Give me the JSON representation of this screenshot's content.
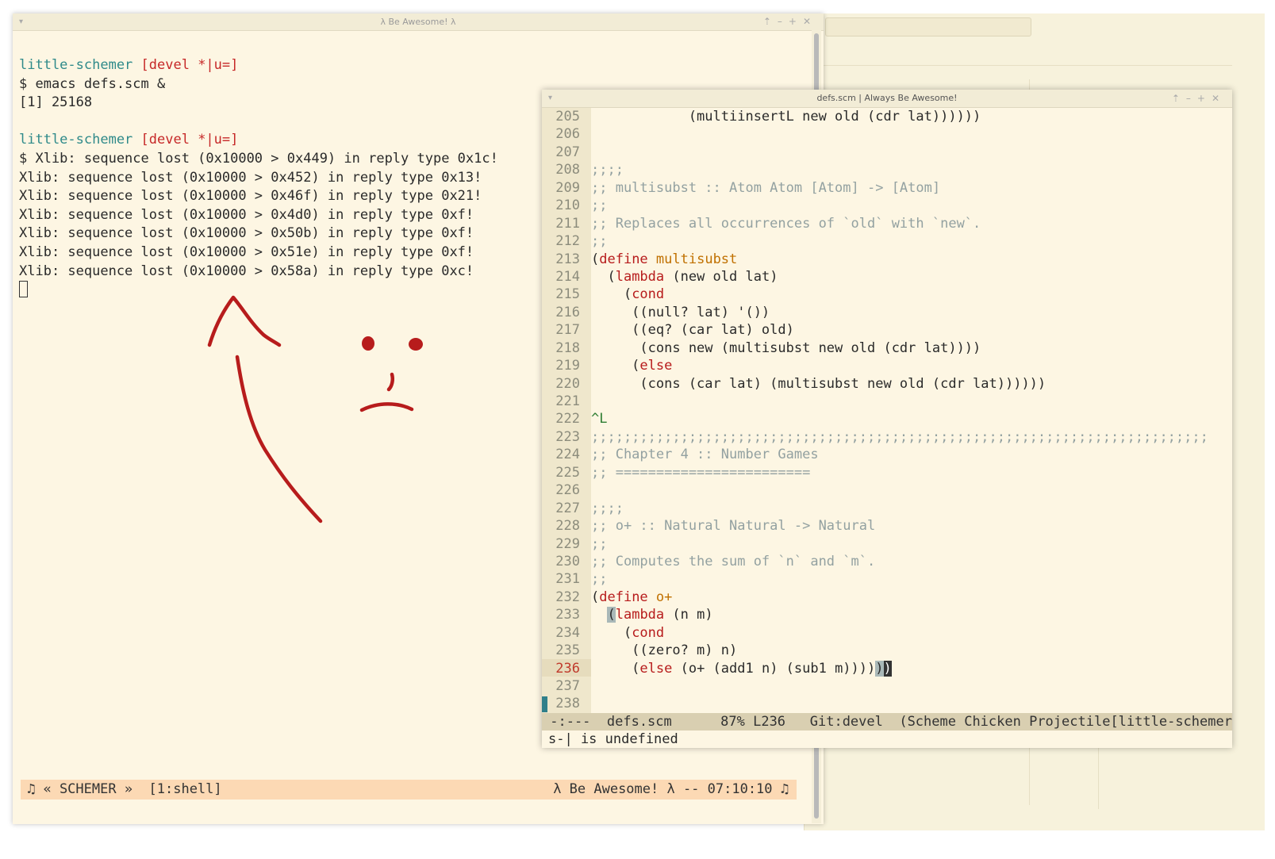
{
  "terminal": {
    "title": "λ Be Awesome! λ",
    "lines": [
      {
        "prompt_dir": "little-schemer",
        "prompt_branch": "[devel *|u=]"
      },
      {
        "text": "$ emacs defs.scm &"
      },
      {
        "text": "[1] 25168"
      },
      {
        "text": ""
      },
      {
        "prompt_dir": "little-schemer",
        "prompt_branch": "[devel *|u=]"
      },
      {
        "text": "$ Xlib: sequence lost (0x10000 > 0x449) in reply type 0x1c!"
      },
      {
        "text": "Xlib: sequence lost (0x10000 > 0x452) in reply type 0x13!"
      },
      {
        "text": "Xlib: sequence lost (0x10000 > 0x46f) in reply type 0x21!"
      },
      {
        "text": "Xlib: sequence lost (0x10000 > 0x4d0) in reply type 0xf!"
      },
      {
        "text": "Xlib: sequence lost (0x10000 > 0x50b) in reply type 0xf!"
      },
      {
        "text": "Xlib: sequence lost (0x10000 > 0x51e) in reply type 0xf!"
      },
      {
        "text": "Xlib: sequence lost (0x10000 > 0x58a) in reply type 0xc!"
      }
    ],
    "status_left": "♫ « SCHEMER »  [1:shell]",
    "status_right": "λ Be Awesome! λ -- 07:10:10 ♫",
    "colors": {
      "prompt_dir": "#2f8a8a",
      "prompt_branch": "#c62828",
      "status_bg": "#fcd9b4",
      "drawing": "#b71c1c"
    }
  },
  "emacs": {
    "title": "defs.scm | Always Be Awesome!",
    "lines": [
      {
        "n": "205",
        "text": "            (multiinsertL new old (cdr lat))))))"
      },
      {
        "n": "206",
        "text": ""
      },
      {
        "n": "207",
        "text": ""
      },
      {
        "n": "208",
        "text": ";;;;",
        "style": "cm"
      },
      {
        "n": "209",
        "text": ";; multisubst :: Atom Atom [Atom] -> [Atom]",
        "style": "cm"
      },
      {
        "n": "210",
        "text": ";;",
        "style": "cm"
      },
      {
        "n": "211",
        "text": ";; Replaces all occurrences of `old` with `new`.",
        "style": "cm"
      },
      {
        "n": "212",
        "text": ";;",
        "style": "cm"
      },
      {
        "n": "213",
        "pre": "(",
        "kw": "define",
        "mid": " ",
        "fn": "multisubst",
        "post": ""
      },
      {
        "n": "214",
        "pre": "  (",
        "kw": "lambda",
        "post": " (new old lat)"
      },
      {
        "n": "215",
        "pre": "    (",
        "kw": "cond",
        "post": ""
      },
      {
        "n": "216",
        "text": "     ((null? lat) '())"
      },
      {
        "n": "217",
        "text": "     ((eq? (car lat) old)"
      },
      {
        "n": "218",
        "text": "      (cons new (multisubst new old (cdr lat))))"
      },
      {
        "n": "219",
        "pre": "     (",
        "kw": "else",
        "post": ""
      },
      {
        "n": "220",
        "text": "      (cons (car lat) (multisubst new old (cdr lat))))))"
      },
      {
        "n": "221",
        "text": ""
      },
      {
        "n": "222",
        "text": "^L",
        "style": "grn"
      },
      {
        "n": "223",
        "text": ";;;;;;;;;;;;;;;;;;;;;;;;;;;;;;;;;;;;;;;;;;;;;;;;;;;;;;;;;;;;;;;;;;;;;;;;;;;;",
        "style": "cm"
      },
      {
        "n": "224",
        "text": ";; Chapter 4 :: Number Games",
        "style": "cm"
      },
      {
        "n": "225",
        "text": ";; ========================",
        "style": "cm"
      },
      {
        "n": "226",
        "text": ""
      },
      {
        "n": "227",
        "text": ";;;;",
        "style": "cm"
      },
      {
        "n": "228",
        "text": ";; o+ :: Natural Natural -> Natural",
        "style": "cm"
      },
      {
        "n": "229",
        "text": ";;",
        "style": "cm"
      },
      {
        "n": "230",
        "text": ";; Computes the sum of `n` and `m`.",
        "style": "cm"
      },
      {
        "n": "231",
        "text": ";;",
        "style": "cm"
      },
      {
        "n": "232",
        "pre": "(",
        "kw": "define",
        "mid": " ",
        "fn": "o+",
        "post": ""
      },
      {
        "n": "233",
        "hlpre": "  ",
        "hl": "(",
        "kw": "lambda",
        "post": " (n m)"
      },
      {
        "n": "234",
        "pre": "    (",
        "kw": "cond",
        "post": ""
      },
      {
        "n": "235",
        "text": "     ((zero? m) n)"
      },
      {
        "n": "236",
        "pre": "     (",
        "kw": "else",
        "post": " (o+ (add1 n) (sub1 m))))",
        "hl_end": ")",
        "cursor": ")",
        "current": true
      },
      {
        "n": "237",
        "text": ""
      },
      {
        "n": "238",
        "text": ""
      }
    ],
    "modeline": " -:---  defs.scm      87% L236   Git:devel  (Scheme Chicken Projectile[little-schemer]",
    "minibuffer": "s-| is undefined"
  }
}
